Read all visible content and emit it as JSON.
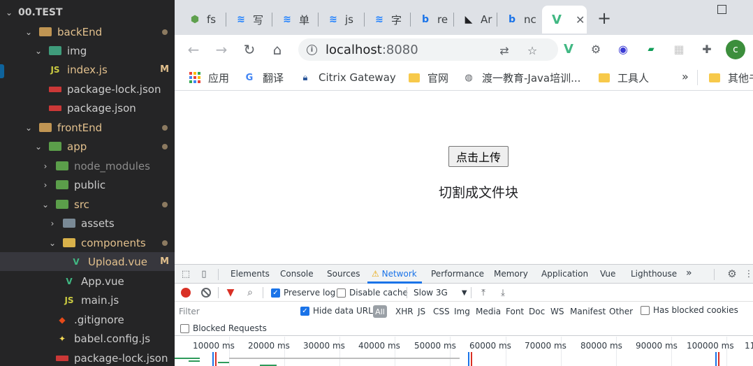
{
  "explorer": {
    "root": "00.TEST",
    "items": [
      {
        "label": "backEnd",
        "badge": "",
        "dot": true
      },
      {
        "label": "img",
        "badge": "",
        "dot": false
      },
      {
        "label": "index.js",
        "badge": "M",
        "dot": false
      },
      {
        "label": "package-lock.json",
        "badge": "",
        "dot": false
      },
      {
        "label": "package.json",
        "badge": "",
        "dot": false
      },
      {
        "label": "frontEnd",
        "badge": "",
        "dot": true
      },
      {
        "label": "app",
        "badge": "",
        "dot": true
      },
      {
        "label": "node_modules",
        "badge": "",
        "dot": false
      },
      {
        "label": "public",
        "badge": "",
        "dot": false
      },
      {
        "label": "src",
        "badge": "",
        "dot": true
      },
      {
        "label": "assets",
        "badge": "",
        "dot": false
      },
      {
        "label": "components",
        "badge": "",
        "dot": true
      },
      {
        "label": "Upload.vue",
        "badge": "M",
        "dot": false
      },
      {
        "label": "App.vue",
        "badge": "",
        "dot": false
      },
      {
        "label": "main.js",
        "badge": "",
        "dot": false
      },
      {
        "label": ".gitignore",
        "badge": "",
        "dot": false
      },
      {
        "label": "babel.config.js",
        "badge": "",
        "dot": false
      },
      {
        "label": "package-lock.json",
        "badge": "",
        "dot": false
      }
    ]
  },
  "browser": {
    "tabs": [
      {
        "label": "fs",
        "icon": "node-icon"
      },
      {
        "label": "写",
        "icon": "juejin-icon"
      },
      {
        "label": "单",
        "icon": "juejin-icon"
      },
      {
        "label": "js",
        "icon": "juejin-icon"
      },
      {
        "label": "字",
        "icon": "juejin-icon"
      },
      {
        "label": "re",
        "icon": "bing-icon"
      },
      {
        "label": "Ar",
        "icon": "ant-icon"
      },
      {
        "label": "nc",
        "icon": "bing-icon"
      },
      {
        "label": "",
        "icon": "vue-icon"
      }
    ],
    "active_tab_close": "✕",
    "new_tab": "+",
    "url": "localhost",
    "url_port": ":8080",
    "bookmarks": [
      {
        "label": "应用",
        "icon": "apps-icon"
      },
      {
        "label": "翻译",
        "icon": "translate-icon"
      },
      {
        "label": "Citrix Gateway",
        "icon": "lock-icon"
      },
      {
        "label": "官网",
        "icon": "folder-icon"
      },
      {
        "label": "渡一教育-Java培训...",
        "icon": "globe-icon"
      },
      {
        "label": "工具人",
        "icon": "folder-icon"
      },
      {
        "label": "其他书签",
        "icon": "folder-icon"
      }
    ],
    "bookmarks_more": "»",
    "avatar_letter": "c"
  },
  "page": {
    "upload_button": "点击上传",
    "status_text": "切割成文件块"
  },
  "devtools": {
    "tabs": [
      "Elements",
      "Console",
      "Sources",
      "Network",
      "Performance",
      "Memory",
      "Application",
      "Vue",
      "Lighthouse"
    ],
    "more_tabs": "»",
    "preserve_log": "Preserve log",
    "disable_cache": "Disable cache",
    "throttle": "Slow 3G",
    "filter_placeholder": "Filter",
    "hide_data_urls": "Hide data URLs",
    "types": [
      "All",
      "XHR",
      "JS",
      "CSS",
      "Img",
      "Media",
      "Font",
      "Doc",
      "WS",
      "Manifest",
      "Other"
    ],
    "has_blocked_cookies": "Has blocked cookies",
    "blocked_requests": "Blocked Requests",
    "timeline_ticks": [
      "10000 ms",
      "20000 ms",
      "30000 ms",
      "40000 ms",
      "50000 ms",
      "60000 ms",
      "70000 ms",
      "80000 ms",
      "90000 ms",
      "100000 ms",
      "11"
    ]
  }
}
